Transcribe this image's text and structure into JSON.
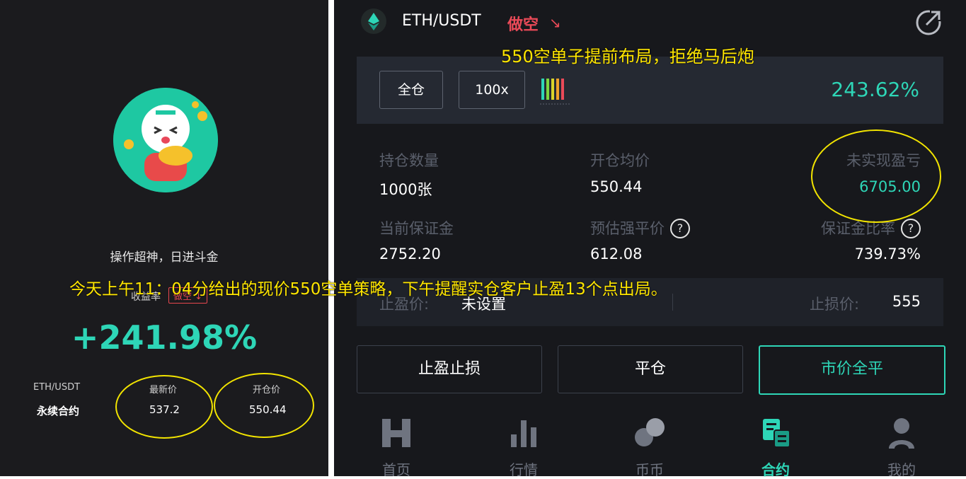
{
  "left_card": {
    "tagline": "操作超神，日进斗金",
    "roi_label": "收益率",
    "side_badge": "做空 ↓",
    "roi_value": "+241.98%",
    "pair": "ETH/USDT",
    "contract_type": "永续合约",
    "latest_price_label": "最新价",
    "latest_price": "537.2",
    "open_price_label": "开仓价",
    "open_price": "550.44",
    "avatar_icon": "tiger-mascot-icon"
  },
  "position": {
    "pair": "ETH/USDT",
    "side": "做空",
    "side_arrow": "↘",
    "margin_mode": "全仓",
    "leverage": "100x",
    "pnl_percent": "243.62%",
    "qty_label": "持仓数量",
    "qty_value": "1000张",
    "avg_open_label": "开仓均价",
    "avg_open_value": "550.44",
    "unrealized_label": "未实现盈亏",
    "unrealized_value": "6705.00",
    "margin_label": "当前保证金",
    "margin_value": "2752.20",
    "liq_label": "预估强平价",
    "liq_value": "612.08",
    "margin_ratio_label": "保证金比率",
    "margin_ratio_value": "739.73%",
    "tp_label": "止盈价:",
    "tp_value": "未设置",
    "sl_label": "止损价:",
    "sl_value": "555",
    "help_glyph": "?"
  },
  "actions": {
    "tpsl": "止盈止损",
    "close": "平仓",
    "market_close": "市价全平"
  },
  "nav": [
    {
      "label": "首页",
      "icon": "home-icon"
    },
    {
      "label": "行情",
      "icon": "market-chart-icon"
    },
    {
      "label": "币币",
      "icon": "coins-icon"
    },
    {
      "label": "合约",
      "icon": "contract-icon"
    },
    {
      "label": "我的",
      "icon": "profile-icon"
    }
  ],
  "annotations": {
    "top_caption": "550空单子提前布局，拒绝马后炮",
    "main_caption": "今天上午11：04分给出的现价550空单策略，下午提醒实仓客户止盈13个点出局。"
  },
  "colors": {
    "accent_green": "#2ed6b7",
    "short_red": "#ea4a58",
    "annotation_yellow": "#ffe600"
  }
}
